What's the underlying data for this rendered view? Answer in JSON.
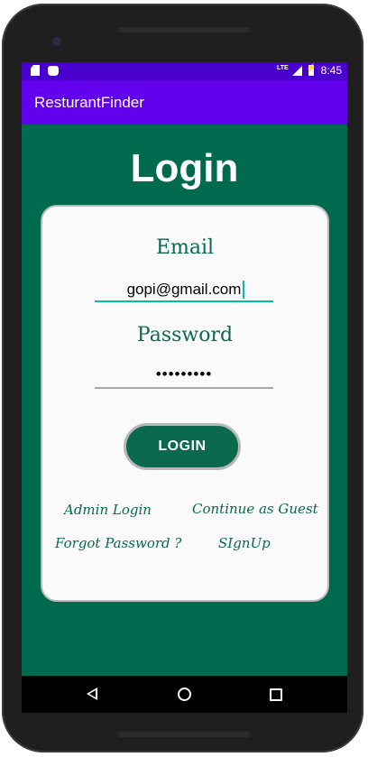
{
  "status_bar": {
    "network": "LTE",
    "time": "8:45"
  },
  "app_bar": {
    "title": "ResturantFinder"
  },
  "login": {
    "title": "Login",
    "email_label": "Email",
    "email_value": "gopi@gmail.com",
    "password_label": "Password",
    "password_value": "•••••••••",
    "login_button": "LOGIN"
  },
  "links": {
    "admin_login": "Admin Login",
    "continue_guest": "Continue as Guest",
    "forgot_password": "Forgot Password ?",
    "signup": "SIgnUp"
  },
  "colors": {
    "status_bar": "#4a00cc",
    "app_bar": "#6200ee",
    "background": "#006a4e",
    "accent": "#00bfa5"
  },
  "icons": [
    "sd-card-icon",
    "android-icon",
    "signal-icon",
    "battery-charging-icon",
    "back-icon",
    "home-icon",
    "recents-icon"
  ]
}
